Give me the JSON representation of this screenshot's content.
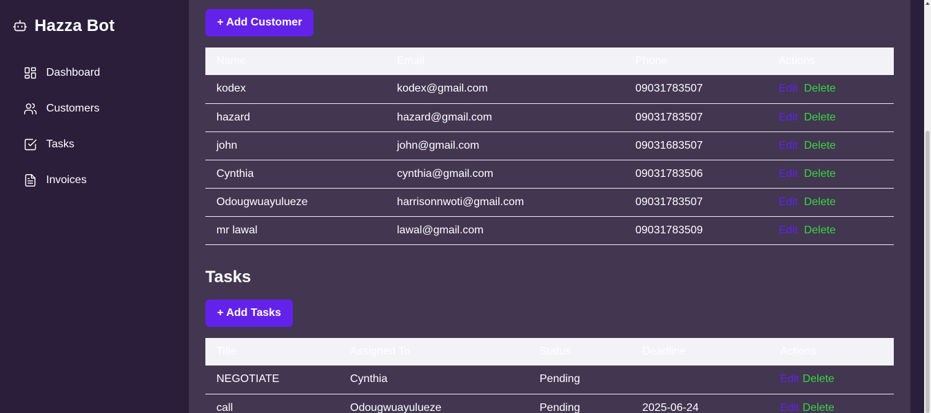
{
  "app": {
    "title": "Hazza Bot",
    "icon": "robot-icon"
  },
  "sidebar": {
    "items": [
      {
        "label": "Dashboard",
        "icon": "dashboard-icon"
      },
      {
        "label": "Customers",
        "icon": "users-icon"
      },
      {
        "label": "Tasks",
        "icon": "checkbox-icon"
      },
      {
        "label": "Invoices",
        "icon": "document-icon"
      }
    ]
  },
  "customers": {
    "add_label": "+ Add Customer",
    "columns": [
      "Name",
      "Email",
      "Phone",
      "Actions"
    ],
    "rows": [
      {
        "name": "kodex",
        "email": "kodex@gmail.com",
        "phone": "09031783507"
      },
      {
        "name": "hazard",
        "email": "hazard@gmail.com",
        "phone": "09031783507"
      },
      {
        "name": "john",
        "email": "john@gmail.com",
        "phone": "09031683507"
      },
      {
        "name": "Cynthia",
        "email": "cynthia@gmail.com",
        "phone": "09031783506"
      },
      {
        "name": "Odougwuayulueze",
        "email": "harrisonnwoti@gmail.com",
        "phone": "09031783507"
      },
      {
        "name": "mr lawal",
        "email": "lawal@gmail.com",
        "phone": "09031783509"
      }
    ],
    "edit_label": "Edit",
    "delete_label": "Delete"
  },
  "tasks": {
    "section_title": "Tasks",
    "add_label": "+ Add Tasks",
    "columns": [
      "Title",
      "Assigned To",
      "Status",
      "Deadline",
      "Actions"
    ],
    "rows": [
      {
        "title": "NEGOTIATE",
        "assigned_to": "Cynthia",
        "status": "Pending",
        "deadline": ""
      },
      {
        "title": "call",
        "assigned_to": "Odougwuayulueze",
        "status": "Pending",
        "deadline": "2025-06-24"
      }
    ],
    "edit_label": "Edit",
    "delete_label": "Delete"
  },
  "colors": {
    "accent": "#6222ea",
    "delete": "#37d63f",
    "sidebar_bg": "#2a1e3b",
    "main_bg": "#423651"
  }
}
